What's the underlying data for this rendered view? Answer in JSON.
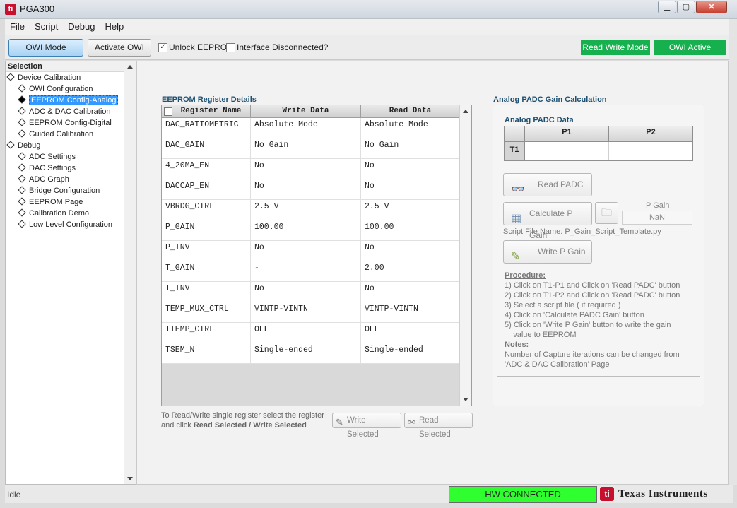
{
  "window": {
    "title": "PGA300",
    "icon": "ti-app-icon",
    "controls": [
      "minimize-icon",
      "maximize-icon",
      "close-icon"
    ]
  },
  "menu": [
    "File",
    "Script",
    "Debug",
    "Help"
  ],
  "toolbar": {
    "owi_mode": "OWI Mode",
    "activate_owi": "Activate OWI",
    "unlock_eeprom": {
      "label": "Unlock EEPROM",
      "checked": true
    },
    "interface_disconnected": {
      "label": "Interface Disconnected?",
      "checked": false
    },
    "read_write_mode": "Read Write Mode",
    "owi_active": "OWI Active",
    "status_green": "#17b04f"
  },
  "sidebar": {
    "header": "Selection",
    "groups": [
      {
        "label": "Device Calibration",
        "items": [
          "OWI Configuration",
          "EEPROM Config-Analog",
          "ADC & DAC Calibration",
          "EEPROM Config-Digital",
          "Guided Calibration"
        ]
      },
      {
        "label": "Debug",
        "items": [
          "ADC Settings",
          "DAC Settings",
          "ADC Graph",
          "Bridge Configuration",
          "EEPROM Page",
          "Calibration Demo",
          "Low Level Configuration"
        ]
      }
    ],
    "selected": "EEPROM Config-Analog",
    "selection_color": "#3399ff"
  },
  "eeprom": {
    "title": "EEPROM Register Details",
    "columns": [
      "Register Name",
      "Write Data",
      "Read Data"
    ],
    "rows": [
      [
        "DAC_RATIOMETRIC",
        "Absolute Mode",
        "Absolute Mode"
      ],
      [
        "DAC_GAIN",
        "No Gain",
        "No Gain"
      ],
      [
        "4_20MA_EN",
        "No",
        "No"
      ],
      [
        "DACCAP_EN",
        "No",
        "No"
      ],
      [
        "VBRDG_CTRL",
        "2.5 V",
        "2.5 V"
      ],
      [
        "P_GAIN",
        "100.00",
        "100.00"
      ],
      [
        "P_INV",
        "No",
        "No"
      ],
      [
        "T_GAIN",
        "-",
        "2.00"
      ],
      [
        "T_INV",
        "No",
        "No"
      ],
      [
        "TEMP_MUX_CTRL",
        "VINTP-VINTN",
        "VINTP-VINTN"
      ],
      [
        "ITEMP_CTRL",
        "OFF",
        "OFF"
      ],
      [
        "TSEM_N",
        "Single-ended",
        "Single-ended"
      ]
    ],
    "hint_line1": "To Read/Write single register select the register",
    "hint_line2_prefix": "and click ",
    "hint_line2_bold": "Read Selected / Write Selected",
    "write_selected": "Write Selected",
    "read_selected": "Read Selected"
  },
  "padc": {
    "title": "Analog PADC Gain Calculation",
    "data_title": "Analog PADC Data",
    "columns": [
      "P1",
      "P2"
    ],
    "row_label": "T1",
    "read_padc": "Read PADC",
    "calculate_p_gain": "Calculate P Gain",
    "p_gain_label": "P Gain",
    "p_gain_value": "NaN",
    "script_file": "Script File Name: P_Gain_Script_Template.py",
    "write_p_gain": "Write P Gain",
    "procedure_title": "Procedure:",
    "procedure": [
      "1) Click on T1-P1 and  Click on 'Read PADC' button",
      "2) Click on T1-P2 and Click on 'Read PADC' button",
      "3) Select a script file ( if required )",
      "4) Click on 'Calculate PADC Gain' button",
      "5) Click on 'Write P Gain' button to write the gain",
      "    value to EEPROM"
    ],
    "notes_title": "Notes:",
    "notes": [
      "Number of Capture iterations can be changed from",
      "'ADC & DAC Calibration' Page"
    ]
  },
  "status": {
    "text": "Idle",
    "hw": "HW CONNECTED",
    "hw_color": "#2fff2f",
    "brand": "Texas Instruments"
  }
}
